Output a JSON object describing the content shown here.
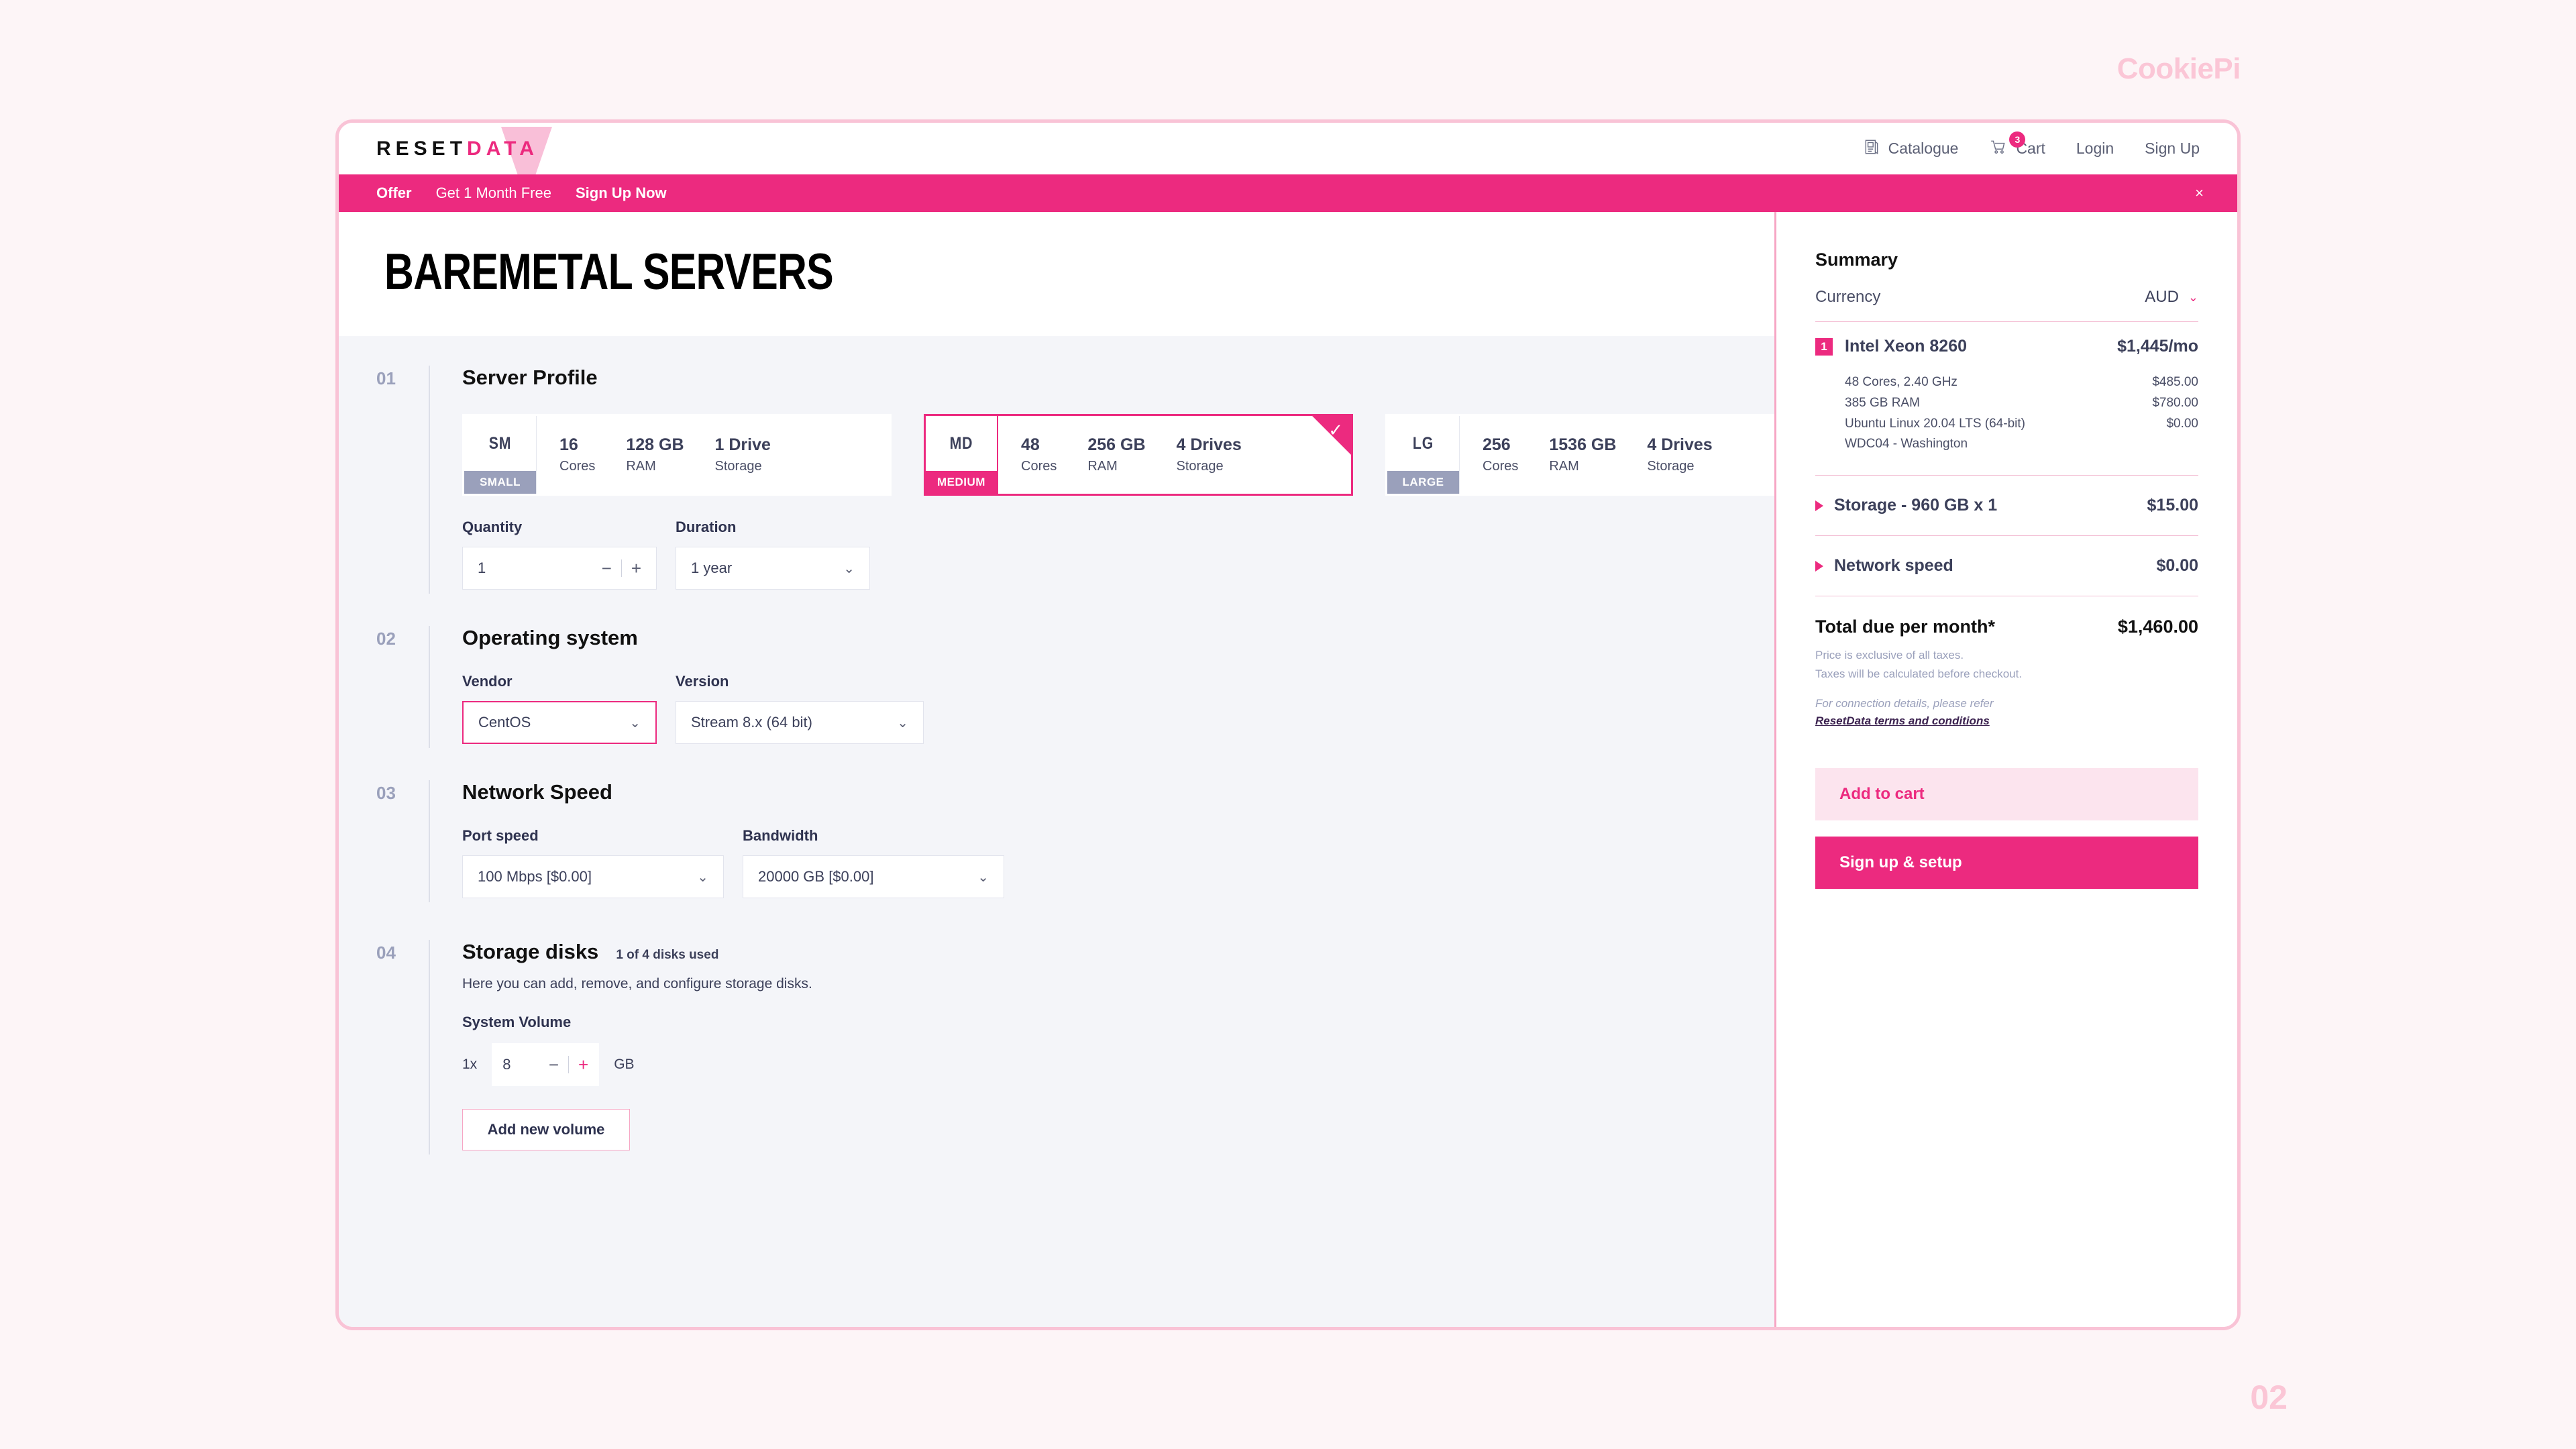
{
  "watermark": {
    "brand": "CookiePi",
    "page_number": "02"
  },
  "topnav": {
    "logo_reset": "RESET",
    "logo_data": "DATA",
    "items": [
      {
        "label": "Catalogue",
        "icon": "catalogue-icon"
      },
      {
        "label": "Cart",
        "icon": "cart-icon",
        "badge": "3"
      },
      {
        "label": "Login"
      },
      {
        "label": "Sign Up"
      }
    ]
  },
  "banner": {
    "offer": "Offer",
    "text": "Get 1 Month Free",
    "cta": "Sign Up Now",
    "close": "×"
  },
  "page": {
    "title": "BAREMETAL SERVERS"
  },
  "sections": {
    "server_profile": {
      "num": "01",
      "title": "Server Profile",
      "cards": [
        {
          "abbr": "SM",
          "size": "SMALL",
          "cores": "16",
          "cores_label": "Cores",
          "ram": "128 GB",
          "ram_label": "RAM",
          "storage": "1 Drive",
          "storage_label": "Storage",
          "selected": false
        },
        {
          "abbr": "MD",
          "size": "MEDIUM",
          "cores": "48",
          "cores_label": "Cores",
          "ram": "256 GB",
          "ram_label": "RAM",
          "storage": "4 Drives",
          "storage_label": "Storage",
          "selected": true
        },
        {
          "abbr": "LG",
          "size": "LARGE",
          "cores": "256",
          "cores_label": "Cores",
          "ram": "1536 GB",
          "ram_label": "RAM",
          "storage": "4 Drives",
          "storage_label": "Storage",
          "selected": false
        }
      ],
      "quantity": {
        "label": "Quantity",
        "value": "1",
        "minus": "−",
        "plus": "+"
      },
      "duration": {
        "label": "Duration",
        "value": "1 year"
      }
    },
    "operating_system": {
      "num": "02",
      "title": "Operating  system",
      "vendor": {
        "label": "Vendor",
        "value": "CentOS"
      },
      "version": {
        "label": "Version",
        "value": "Stream 8.x (64 bit)"
      }
    },
    "network_speed": {
      "num": "03",
      "title": "Network Speed",
      "port_speed": {
        "label": "Port speed",
        "value": "100 Mbps [$0.00]"
      },
      "bandwidth": {
        "label": "Bandwidth",
        "value": "20000 GB [$0.00]"
      }
    },
    "storage_disks": {
      "num": "04",
      "title": "Storage disks",
      "note": "1 of 4 disks used",
      "description": "Here you can add, remove, and configure storage disks.",
      "volume_label": "System Volume",
      "volume_multiplier": "1x",
      "volume_value": "8",
      "volume_minus": "−",
      "volume_plus": "+",
      "volume_unit": "GB",
      "add_button": "Add new volume"
    }
  },
  "summary": {
    "title": "Summary",
    "currency_label": "Currency",
    "currency_value": "AUD",
    "item": {
      "qty": "1",
      "name": "Intel Xeon 8260",
      "price": "$1,445/mo",
      "details": [
        {
          "label": "48 Cores, 2.40 GHz",
          "price": "$485.00"
        },
        {
          "label": "385 GB RAM",
          "price": "$780.00"
        },
        {
          "label": "Ubuntu Linux 20.04 LTS (64-bit)",
          "price": "$0.00"
        },
        {
          "label": "WDC04 - Washington",
          "price": ""
        }
      ]
    },
    "rows": [
      {
        "name": "Storage - 960 GB x 1",
        "price": "$15.00"
      },
      {
        "name": "Network speed",
        "price": "$0.00"
      }
    ],
    "total_label": "Total due per month*",
    "total_value": "$1,460.00",
    "fine_line_1": "Price is exclusive of all taxes.",
    "fine_line_2": "Taxes will be calculated before checkout.",
    "fine_italic": "For connection details, please refer",
    "fine_link": "ResetData terms and conditions",
    "add_to_cart": "Add to cart",
    "sign_up_setup": "Sign up & setup"
  },
  "colors": {
    "accent": "#ec2a7f",
    "accent_soft": "#fce4ee",
    "neutral": "#9aa0bb"
  }
}
